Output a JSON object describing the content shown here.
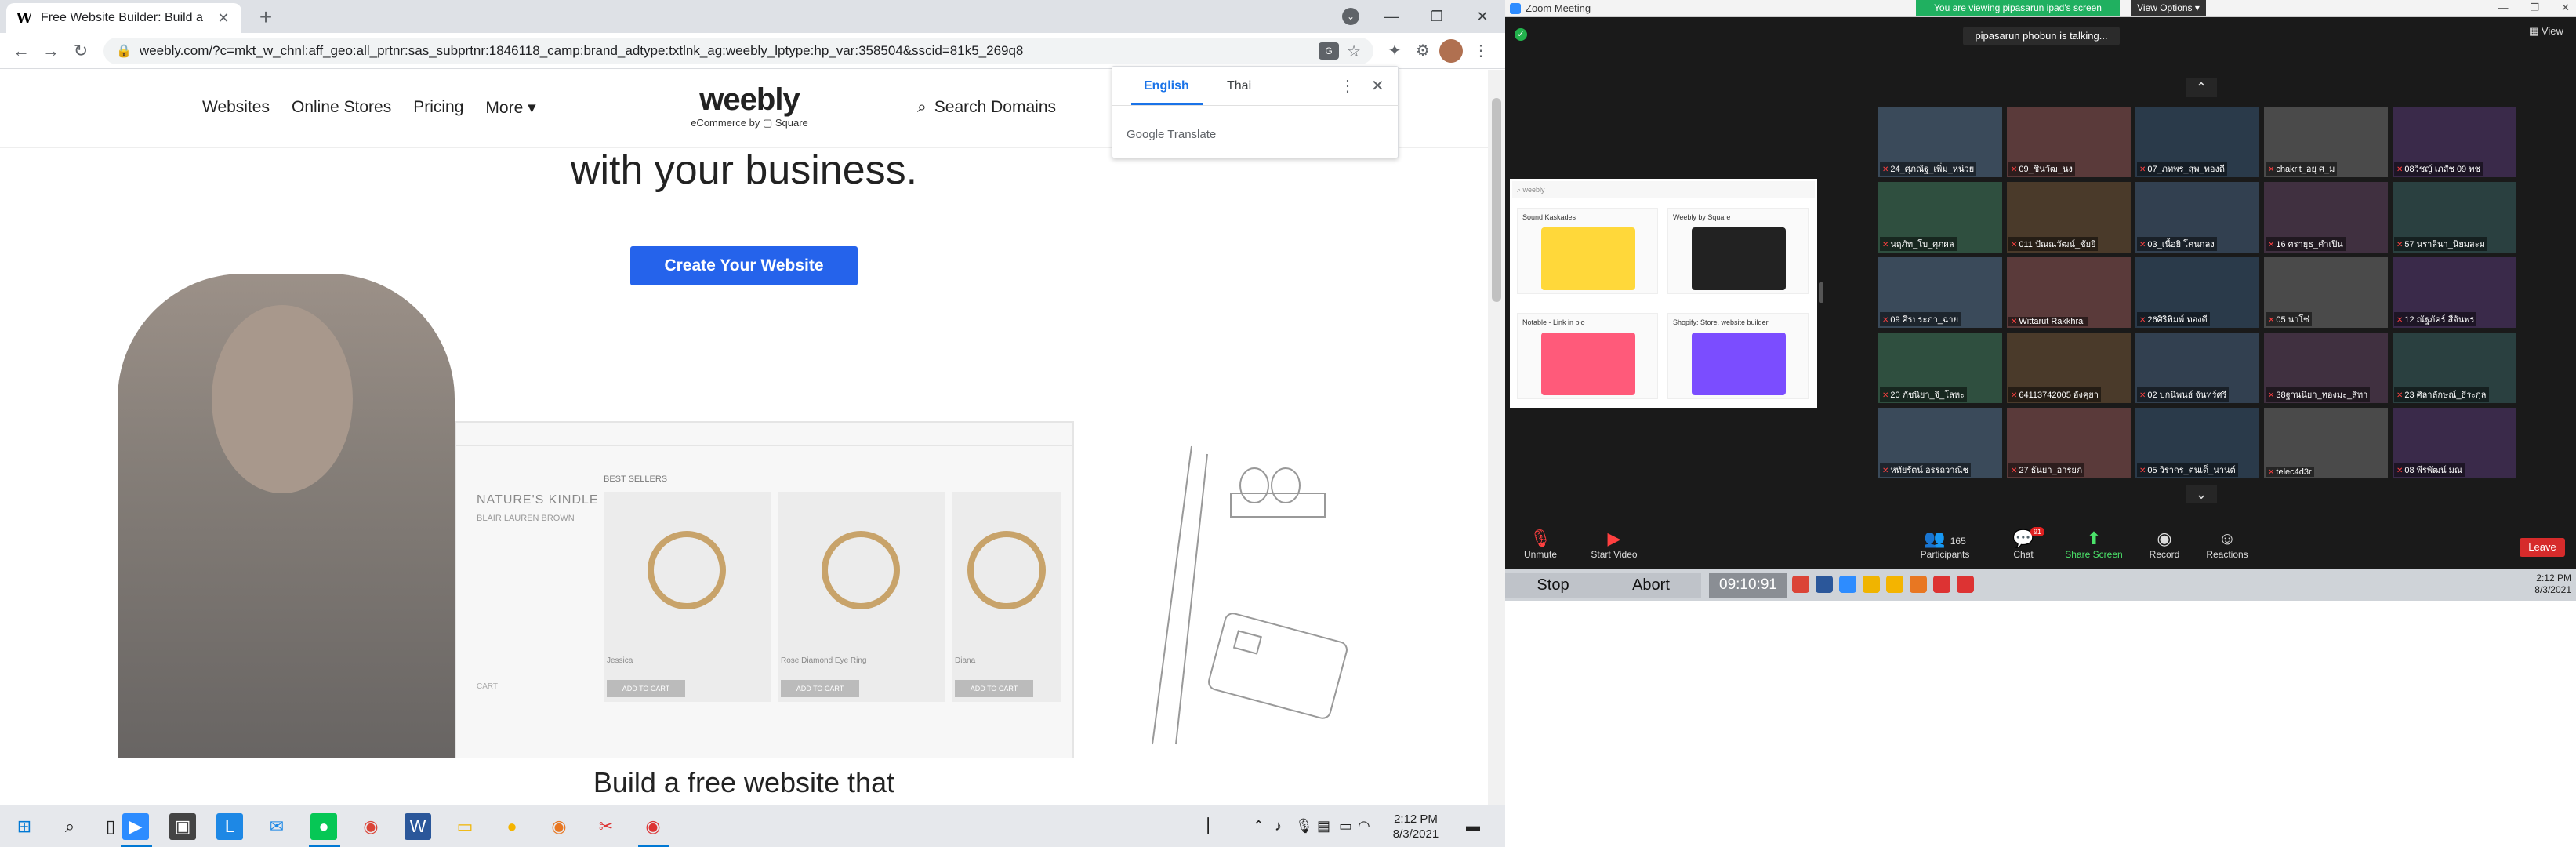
{
  "browser": {
    "tab_title": "Free Website Builder: Build a Fre",
    "tab_favicon": "W",
    "url": "weebly.com/?c=mkt_w_chnl:aff_geo:all_prtnr:sas_subprtnr:1846118_camp:brand_adtype:txtlnk_ag:weebly_lptype:hp_var:358504&sscid=81k5_269q8"
  },
  "site": {
    "nav_links": [
      "Websites",
      "Online Stores",
      "Pricing",
      "More ▾"
    ],
    "logo": "weebly",
    "logo_sub": "eCommerce by ▢ Square",
    "search": "Search Domains",
    "hero_title": "with your business.",
    "cta": "Create Your Website",
    "section2_title": "Build a free website that",
    "mock": {
      "brand": "NATURE'S KINDLE",
      "brand_sub": "BLAIR LAUREN BROWN",
      "best_sellers": "BEST SELLERS",
      "products": [
        {
          "name": "Jessica",
          "button": "ADD TO CART"
        },
        {
          "name": "Rose Diamond Eye Ring",
          "button": "ADD TO CART"
        },
        {
          "name": "Diana",
          "button": "ADD TO CART"
        }
      ],
      "cart": "CART"
    }
  },
  "translate": {
    "lang_from": "English",
    "lang_to": "Thai",
    "brand": "Google Translate"
  },
  "taskbar": {
    "time": "2:12 PM",
    "date": "8/3/2021"
  },
  "zoom": {
    "window_title": "Zoom Meeting",
    "viewing_banner": "You are viewing pipasarun ipad's screen",
    "view_options": "View Options ▾",
    "talking": "pipasarun phobun is talking...",
    "view_label": "View",
    "participants": [
      "24_ศุภณัฐ_เพิ่ม_หน่วย",
      "09_ชินวัฒ_นง",
      "07_ภทพร_สุพ_ทองดี",
      "chakrit_อยุ ศ_ม",
      "08วิชญ์ เภสัช 09 พช",
      "นฤภัท_โบ_ศุภผล",
      "011 ปัณณวัฒน์_ชัยยิ",
      "03_เนื้อยิ โคนกลง",
      "16 ศรายุธ_คำเปิน",
      "57 นราลินา_นิยมสะม",
      "09 ศิรประภา_ฉาย",
      "Wittarut Rakkhrai",
      "26ศิริพิมพ์ ทองดี",
      "05 นาโซ่",
      "12 ณัฐภัคร์ สีจันพร",
      "20 ภัชนิยา_จิ_โลหะ",
      "64113742005 อังคุยา",
      "02 ปกนิพนธ์ จันทร์ศรี",
      "38ฐานนิยา_ทองมะ_สีทา",
      "23 ศิลาลักษณ์_ธีระกุล",
      "หทัยรัตน์ อรรถวาณิช",
      "27 ธันยา_อารยภ",
      "05 วิรากร_ตนเด็_นานต์",
      "telec4d3r",
      "08 พีรพัฒน์ มณ"
    ],
    "controls": {
      "unmute": "Unmute",
      "start_video": "Start Video",
      "participants": "Participants",
      "participants_count": "165",
      "chat": "Chat",
      "chat_badge": "91",
      "share_screen": "Share Screen",
      "record": "Record",
      "reactions": "Reactions",
      "leave": "Leave"
    },
    "rec": {
      "stop": "Stop",
      "abort": "Abort",
      "timer": "09:10:91"
    },
    "clock_time": "2:12 PM",
    "clock_date": "8/3/2021",
    "shared_apps": [
      "Sound Kaskades",
      "Weebly by Square",
      "Notable - Link in bio",
      "Shopify: Store, website builder"
    ]
  }
}
